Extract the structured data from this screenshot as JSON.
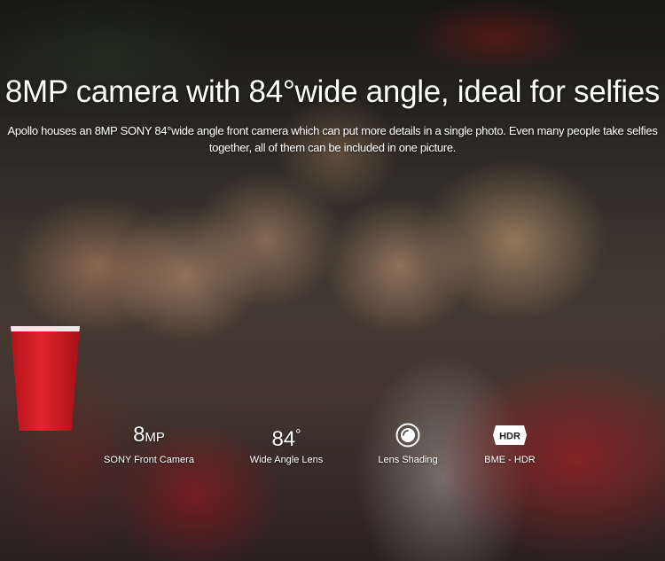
{
  "headline": "8MP camera with 84°wide angle, ideal for selfies",
  "description": "Apollo houses an 8MP SONY 84°wide angle front camera which can put more details in a single photo. Even many people take selfies together, all of them can be included in one picture.",
  "features": [
    {
      "value": "8",
      "unit": "MP",
      "label": "SONY Front Camera"
    },
    {
      "value": "84",
      "unit": "°",
      "label": "Wide Angle Lens"
    },
    {
      "icon": "lens-shading-icon",
      "label": "Lens Shading"
    },
    {
      "icon": "hdr-icon",
      "icon_text": "HDR",
      "label": "BME - HDR"
    }
  ]
}
